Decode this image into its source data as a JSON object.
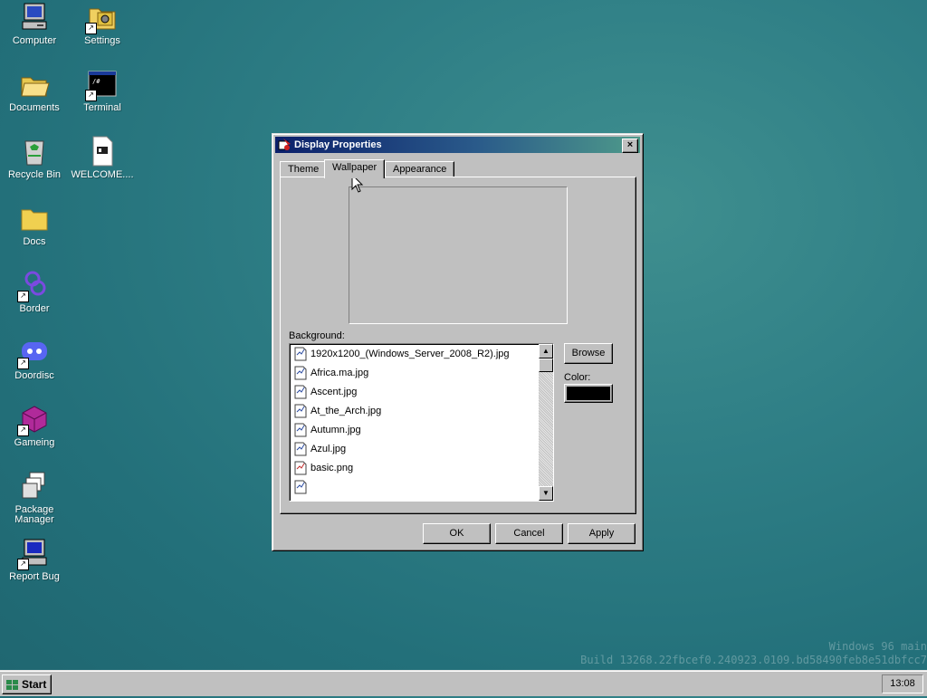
{
  "desktop": {
    "icons": [
      {
        "label": "Computer"
      },
      {
        "label": "Settings"
      },
      {
        "label": "Documents"
      },
      {
        "label": "Terminal"
      },
      {
        "label": "Recycle Bin"
      },
      {
        "label": "WELCOME...."
      },
      {
        "label": "Docs"
      },
      {
        "label": "Border"
      },
      {
        "label": "Doordisc"
      },
      {
        "label": "Gameing"
      },
      {
        "label": "Package Manager"
      },
      {
        "label": "Report Bug"
      }
    ]
  },
  "window": {
    "title": "Display Properties",
    "close_label": "×",
    "tabs": [
      {
        "label": "Theme"
      },
      {
        "label": "Wallpaper",
        "active": true
      },
      {
        "label": "Appearance"
      }
    ],
    "background_label": "Background:",
    "files": [
      {
        "name": "1920x1200_(Windows_Server_2008_R2).jpg"
      },
      {
        "name": "Africa.ma.jpg"
      },
      {
        "name": "Ascent.jpg"
      },
      {
        "name": "At_the_Arch.jpg"
      },
      {
        "name": "Autumn.jpg"
      },
      {
        "name": "Azul.jpg"
      },
      {
        "name": "basic.png"
      },
      {
        "name": ""
      }
    ],
    "browse_label": "Browse",
    "color_label": "Color:",
    "color_value": "#000000",
    "ok_label": "OK",
    "cancel_label": "Cancel",
    "apply_label": "Apply"
  },
  "taskbar": {
    "start_label": "Start",
    "clock": "13:08"
  },
  "watermark": {
    "line1": "Windows 96 main",
    "line2": "Build 13268.22fbcef0.240923.0109.bd58490feb8e51dbfcc7"
  }
}
